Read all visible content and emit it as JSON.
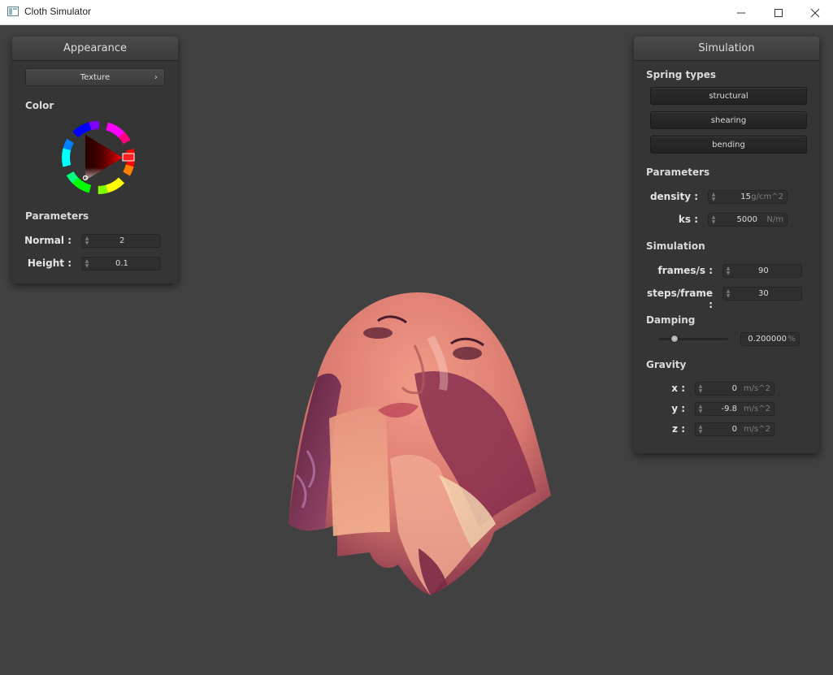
{
  "window": {
    "title": "Cloth Simulator",
    "controls": [
      "minimize-icon",
      "maximize-icon",
      "close-icon"
    ]
  },
  "appearance": {
    "title": "Appearance",
    "texture_button": "Texture",
    "texture_chevron": "›",
    "color_label": "Color",
    "selected_hue_color": "#ff0000",
    "parameters_label": "Parameters",
    "normal": {
      "label": "Normal :",
      "value": "2"
    },
    "height": {
      "label": "Height :",
      "value": "0.1"
    }
  },
  "simulation": {
    "title": "Simulation",
    "spring_types_label": "Spring types",
    "spring_types": [
      "structural",
      "shearing",
      "bending"
    ],
    "parameters_label": "Parameters",
    "density": {
      "label": "density :",
      "value": "15",
      "unit": "g/cm^2"
    },
    "ks": {
      "label": "ks :",
      "value": "5000",
      "unit": "N/m"
    },
    "simulation_label": "Simulation",
    "frames_per_s": {
      "label": "frames/s :",
      "value": "90"
    },
    "steps_per_frame": {
      "label": "steps/frame :",
      "value": "30"
    },
    "damping_label": "Damping",
    "damping": {
      "value": "0.200000",
      "unit": "%",
      "slider_fraction": 0.2
    },
    "gravity_label": "Gravity",
    "gravity": [
      {
        "label": "x :",
        "value": "0",
        "unit": "m/s^2"
      },
      {
        "label": "y :",
        "value": "-9.8",
        "unit": "m/s^2"
      },
      {
        "label": "z :",
        "value": "0",
        "unit": "m/s^2"
      }
    ]
  },
  "colors": {
    "background": "#414141",
    "panel": "#353535",
    "accent_hue": "#ff0000"
  }
}
